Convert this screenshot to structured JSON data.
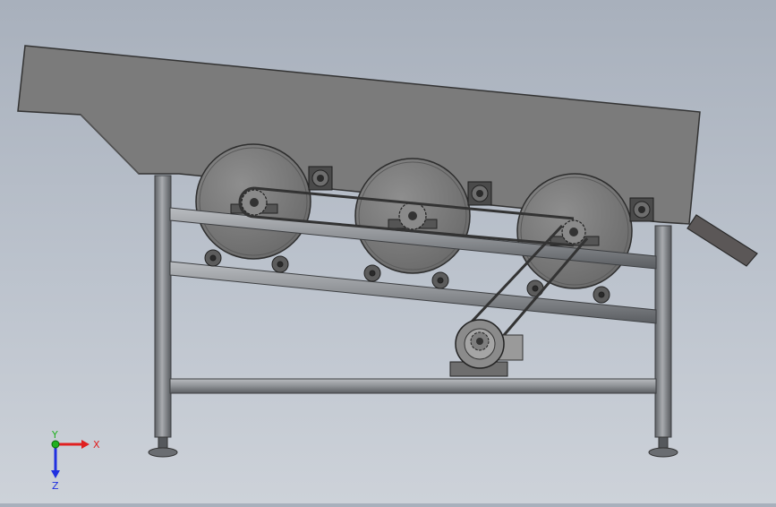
{
  "viewport": {
    "background_top": "#a8b0bc",
    "background_bottom": "#cdd2d9"
  },
  "model": {
    "description_kind": "cad-assembly-side-view",
    "colors": {
      "hopper": "#7a7a7a",
      "hopper_edge": "#3a3a3a",
      "frame": "#8c8e91",
      "frame_dark": "#4a4c4f",
      "wheel": "#7c7c7c",
      "belt": "#3c3c3c",
      "motor": "#8a8a8a",
      "chute": "#5a5656"
    }
  },
  "triad": {
    "x_label": "X",
    "y_label": "Y",
    "z_label": "Z",
    "x_color": "#e02020",
    "y_color": "#20b020",
    "z_color": "#2030e0"
  }
}
